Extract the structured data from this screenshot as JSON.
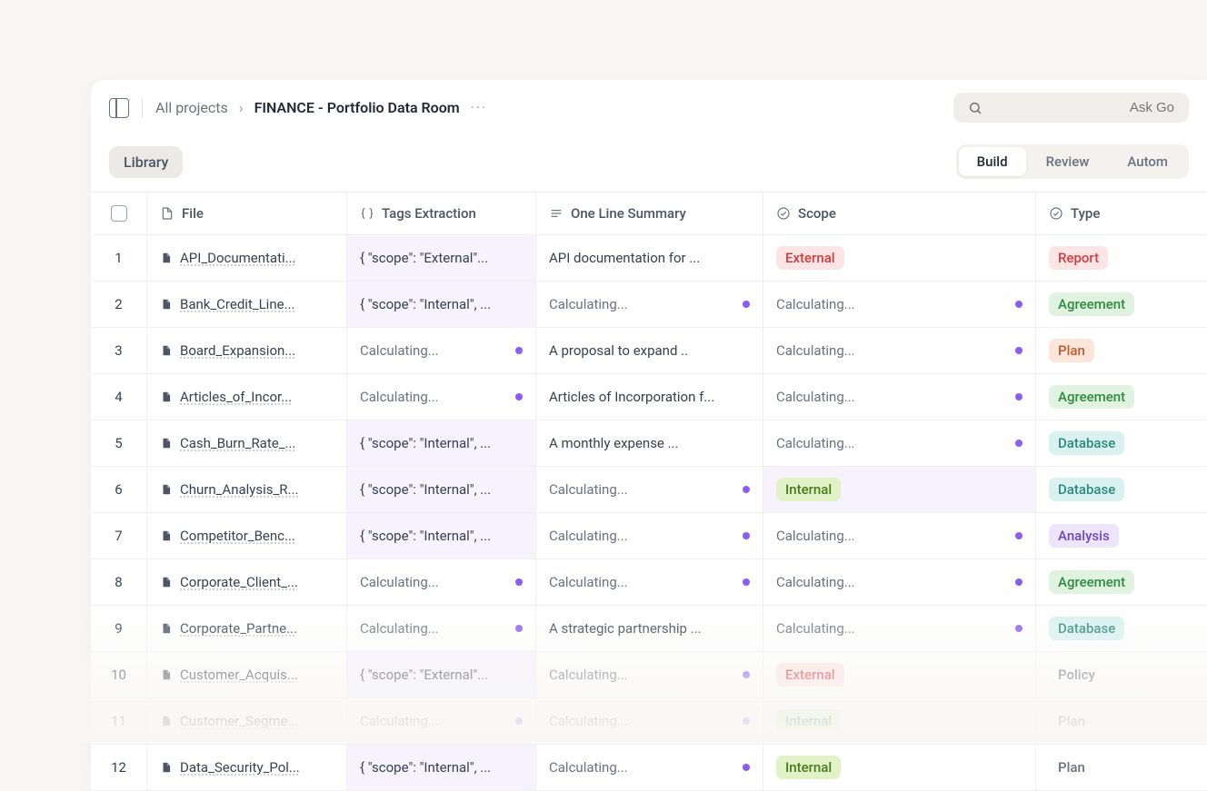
{
  "breadcrumb": {
    "root": "All projects",
    "current": "FINANCE - Portfolio Data Room",
    "more": "···"
  },
  "search": {
    "placeholder": "Ask Go"
  },
  "library_chip": "Library",
  "tabs": {
    "build": "Build",
    "review": "Review",
    "automate": "Autom"
  },
  "columns": {
    "file": "File",
    "tags": "Tags Extraction",
    "summary": "One Line Summary",
    "scope": "Scope",
    "type": "Type"
  },
  "calculating": "Calculating...",
  "rows": [
    {
      "n": "1",
      "file": "API_Documentati...",
      "tags": "{ \"scope\": \"External\"...",
      "tags_calc": false,
      "tags_hl": true,
      "summary": "API documentation for ...",
      "summary_calc": false,
      "scope": "External",
      "scope_calc": false,
      "scope_pill": "pill-red",
      "type": "Report",
      "type_pill": "pill-red"
    },
    {
      "n": "2",
      "file": "Bank_Credit_Line...",
      "tags": "{ \"scope\": \"Internal\", ...",
      "tags_calc": false,
      "tags_hl": true,
      "summary": "",
      "summary_calc": true,
      "scope": "",
      "scope_calc": true,
      "type": "Agreement",
      "type_pill": "pill-green"
    },
    {
      "n": "3",
      "file": "Board_Expansion...",
      "tags": "",
      "tags_calc": true,
      "summary": "A proposal to expand ..",
      "summary_calc": false,
      "scope": "",
      "scope_calc": true,
      "type": "Plan",
      "type_pill": "pill-orange"
    },
    {
      "n": "4",
      "file": "Articles_of_Incor...",
      "tags": "",
      "tags_calc": true,
      "summary": "Articles of Incorporation f...",
      "summary_calc": false,
      "scope": "",
      "scope_calc": true,
      "type": "Agreement",
      "type_pill": "pill-green"
    },
    {
      "n": "5",
      "file": "Cash_Burn_Rate_...",
      "tags": "{ \"scope\": \"Internal\", ...",
      "tags_calc": false,
      "tags_hl": true,
      "summary": "A monthly expense ...",
      "summary_calc": false,
      "scope": "",
      "scope_calc": true,
      "type": "Database",
      "type_pill": "pill-teal"
    },
    {
      "n": "6",
      "file": "Churn_Analysis_R...",
      "tags": "{ \"scope\": \"Internal\", ...",
      "tags_calc": false,
      "tags_hl": true,
      "summary": "",
      "summary_calc": true,
      "scope": "Internal",
      "scope_calc": false,
      "scope_pill": "pill-green-dk",
      "scope_hl": true,
      "type": "Database",
      "type_pill": "pill-teal"
    },
    {
      "n": "7",
      "file": "Competitor_Benc...",
      "tags": "{ \"scope\": \"Internal\", ...",
      "tags_calc": false,
      "tags_hl": true,
      "summary": "",
      "summary_calc": true,
      "scope": "",
      "scope_calc": true,
      "type": "Analysis",
      "type_pill": "pill-violet"
    },
    {
      "n": "8",
      "file": "Corporate_Client_...",
      "tags": "",
      "tags_calc": true,
      "summary": "",
      "summary_calc": true,
      "scope": "",
      "scope_calc": true,
      "type": "Agreement",
      "type_pill": "pill-green"
    },
    {
      "n": "9",
      "file": "Corporate_Partne...",
      "tags": "",
      "tags_calc": true,
      "summary": "A strategic partnership ...",
      "summary_calc": false,
      "scope": "",
      "scope_calc": true,
      "type": "Database",
      "type_pill": "pill-teal"
    },
    {
      "n": "10",
      "file": "Customer_Acquis...",
      "tags": "{ \"scope\": \"External\"...",
      "tags_calc": false,
      "tags_hl": true,
      "summary": "",
      "summary_calc": true,
      "scope": "External",
      "scope_calc": false,
      "scope_pill": "pill-red",
      "type": "Policy",
      "type_pill": "pill-plain"
    },
    {
      "n": "11",
      "file": "Customer_Segme...",
      "tags": "",
      "tags_calc": true,
      "summary": "",
      "summary_calc": true,
      "scope": "Internal",
      "scope_calc": false,
      "scope_pill": "pill-green-dk",
      "type": "Plan",
      "type_pill": "pill-plain"
    },
    {
      "n": "12",
      "file": "Data_Security_Pol...",
      "tags": "{ \"scope\": \"Internal\", ...",
      "tags_calc": false,
      "tags_hl": true,
      "summary": "",
      "summary_calc": true,
      "scope": "Internal",
      "scope_calc": false,
      "scope_pill": "pill-green-dk",
      "type": "Plan",
      "type_pill": "pill-plain"
    }
  ]
}
